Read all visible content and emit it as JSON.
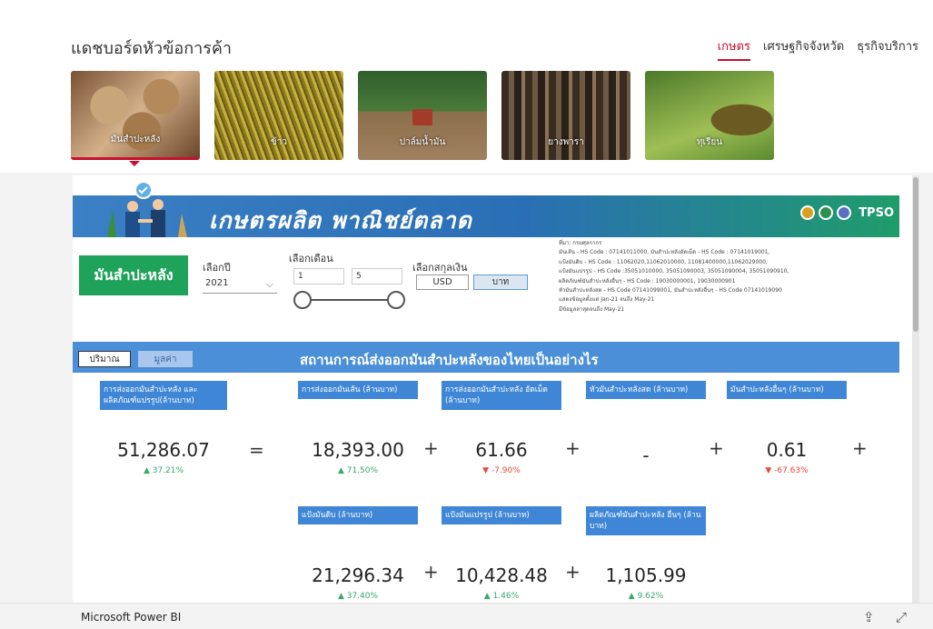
{
  "dashboard": {
    "title": "แดชบอร์ดหัวข้อการค้า",
    "nav_tabs": [
      {
        "label": "เกษตร",
        "active": true
      },
      {
        "label": "เศรษฐกิจจังหวัด",
        "active": false
      },
      {
        "label": "ธุรกิจบริการ",
        "active": false
      }
    ],
    "tiles": [
      {
        "label": "มันสำปะหลัง",
        "active": true
      },
      {
        "label": "ข้าว",
        "active": false
      },
      {
        "label": "ปาล์มน้ำมัน",
        "active": false
      },
      {
        "label": "ยางพารา",
        "active": false
      },
      {
        "label": "ทุเรียน",
        "active": false
      }
    ]
  },
  "report": {
    "banner_title": "เกษตรผลิต พาณิชย์ตลาด",
    "logo_text": "TPSO",
    "product_label": "มันสำปะหลัง",
    "year_label": "เลือกปี",
    "year_value": "2021",
    "month_label": "เลือกเดือน",
    "month_from": "1",
    "month_to": "5",
    "currency_label": "เลือกสกุลเงิน",
    "currency_options": [
      "USD",
      "บาท"
    ],
    "currency_selected": "บาท",
    "source_notes": [
      "ที่มา: กรมศุลกากร",
      "มันเส้น - HS Code : 07141011000, มันสำปะหลังอัดเม็ด - HS Code : 07141019001,",
      "แป้งมันดิบ - HS Code : 11062020,11062010000, 11081400000,11062029000,",
      "แป้งมันแปรรูป - HS Code :35051010000, 35051090003, 35051090004, 35051090910,",
      "ผลิตภัณฑ์มันสำปะหลังอื่นๆ - HS Code : 19030000001, 19030000901",
      "หัวมันสำปะหลังสด - HS Code 07141099001, มันสำปะหลังอื่นๆ - HS Code 07141019090",
      "แสดงข้อมูลตั้งแต่  Jan-21  จนถึง  May-21",
      "มีข้อมูลล่าสุดจนถึง  May-21"
    ],
    "section_title": "สถานการณ์ส่งออกมันสำปะหลังของไทยเป็นอย่างไร",
    "toggle_quantity": "ปริมาณ",
    "toggle_value": "มูลค่า",
    "total": {
      "header": "การส่งออกมันสำปะหลัง และผลิตภัณฑ์แปรรูป(ล้านบาท)",
      "value": "51,286.07",
      "change": "37.21%",
      "direction": "up"
    },
    "cards": [
      {
        "header": "การส่งออกมันเส้น (ล้านบาท)",
        "value": "18,393.00",
        "change": "71.50%",
        "direction": "up"
      },
      {
        "header": "การส่งออกมันสำปะหลัง อัดเม็ด (ล้านบาท)",
        "value": "61.66",
        "change": "-7.90%",
        "direction": "down"
      },
      {
        "header": "หัวมันสำปะหลังสด (ล้านบาท)",
        "value": "-",
        "change": "",
        "direction": "none"
      },
      {
        "header": "มันสำปะหลังอื่นๆ (ล้านบาท)",
        "value": "0.61",
        "change": "-67.63%",
        "direction": "down"
      },
      {
        "header": "แป้งมันดิบ (ล้านบาท)",
        "value": "21,296.34",
        "change": "37.40%",
        "direction": "up"
      },
      {
        "header": "แป้งมันแปรรูป (ล้านบาท)",
        "value": "10,428.48",
        "change": "1.46%",
        "direction": "up"
      },
      {
        "header": "ผลิตภัณฑ์มันสำปะหลัง อื่นๆ (ล้านบาท)",
        "value": "1,105.99",
        "change": "9.62%",
        "direction": "up"
      }
    ],
    "equals": "=",
    "plus": "+"
  },
  "footer": {
    "brand": "Microsoft Power BI",
    "share_icon": "share-icon",
    "fullscreen_icon": "fullscreen-icon"
  },
  "colors": {
    "accent_red": "#c8102e",
    "banner_blue": "#2a6fb5",
    "section_blue": "#4a8fd8",
    "card_header_blue": "#3f87d6",
    "product_green": "#1fa35a",
    "up_green": "#3aa76d",
    "down_red": "#e8473c"
  }
}
